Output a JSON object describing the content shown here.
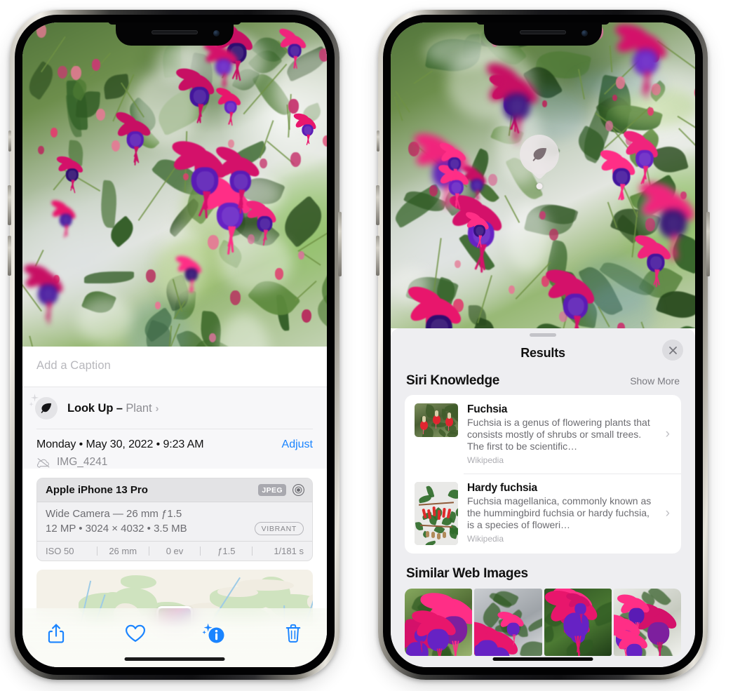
{
  "left_phone": {
    "name": "photos-detail-view",
    "caption_placeholder": "Add a Caption",
    "lookup": {
      "label": "Look Up",
      "dash": " – ",
      "subject": "Plant",
      "chevron": "›",
      "icon": "leaf-icon"
    },
    "date_line": "Monday • May 30, 2022 • 9:23 AM",
    "adjust_label": "Adjust",
    "file_name": "IMG_4241",
    "cloud_icon": "icloud-slash-icon",
    "exif": {
      "device": "Apple iPhone 13 Pro",
      "format_badge": "JPEG",
      "aperture_icon": "aperture-icon",
      "lens": "Wide Camera — 26 mm ƒ1.5",
      "size_line": "12 MP • 3024 × 4032 • 3.5 MB",
      "style_badge": "VIBRANT",
      "settings": [
        "ISO 50",
        "26 mm",
        "0 ev",
        "ƒ1.5",
        "1/181 s"
      ]
    },
    "toolbar": {
      "share_label": "share-icon",
      "favorite_label": "heart-icon",
      "info_label": "info-sparkle-icon",
      "delete_label": "trash-icon"
    }
  },
  "right_phone": {
    "name": "visual-lookup-results",
    "badge_icon": "leaf-icon",
    "sheet": {
      "title": "Results",
      "close_icon": "close-icon",
      "siri_knowledge": {
        "section_title": "Siri Knowledge",
        "show_more": "Show More",
        "items": [
          {
            "title": "Fuchsia",
            "description": "Fuchsia is a genus of flowering plants that consists mostly of shrubs or small trees. The first to be scientific…",
            "source": "Wikipedia",
            "chevron": "›"
          },
          {
            "title": "Hardy fuchsia",
            "description": "Fuchsia magellanica, commonly known as the hummingbird fuchsia or hardy fuchsia, is a species of floweri…",
            "source": "Wikipedia",
            "chevron": "›"
          }
        ]
      },
      "similar_web_images": {
        "section_title": "Similar Web Images",
        "count": 4
      }
    }
  },
  "colors": {
    "accent_blue": "#1a84ff",
    "sheet_bg": "#eeeef1",
    "card_bg": "#ffffff",
    "secondary_text": "#8e8e93"
  }
}
